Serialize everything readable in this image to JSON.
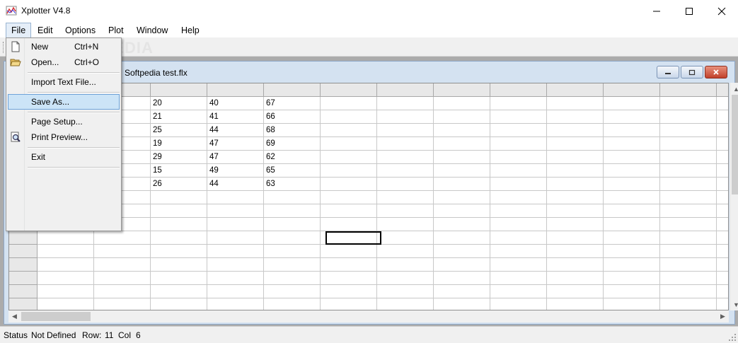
{
  "app": {
    "title": "Xplotter V4.8"
  },
  "menubar": {
    "items": [
      "File",
      "Edit",
      "Options",
      "Plot",
      "Window",
      "Help"
    ]
  },
  "toolbar": {
    "watermark": "SOFTPEDIA"
  },
  "child_window": {
    "title": "Softpedia test.flx"
  },
  "grid": {
    "rows": [
      [
        "20",
        "40",
        "67"
      ],
      [
        "21",
        "41",
        "66"
      ],
      [
        "25",
        "44",
        "68"
      ],
      [
        "19",
        "47",
        "69"
      ],
      [
        "29",
        "47",
        "62"
      ],
      [
        "15",
        "49",
        "65"
      ],
      [
        "26",
        "44",
        "63"
      ]
    ]
  },
  "file_menu": {
    "new": {
      "label": "New",
      "shortcut": "Ctrl+N"
    },
    "open": {
      "label": "Open...",
      "shortcut": "Ctrl+O"
    },
    "import": {
      "label": "Import Text File..."
    },
    "save_as": {
      "label": "Save As..."
    },
    "page_setup": {
      "label": "Page Setup..."
    },
    "print_preview": {
      "label": "Print Preview..."
    },
    "exit": {
      "label": "Exit"
    }
  },
  "status": {
    "label": "Status",
    "value": "Not Defined",
    "row_label": "Row:",
    "row_value": "11",
    "col_label": "Col",
    "col_value": "6"
  },
  "colors": {
    "selection": "#cce4f7",
    "selection_border": "#6ea3d9",
    "close_button": "#c1402b"
  }
}
